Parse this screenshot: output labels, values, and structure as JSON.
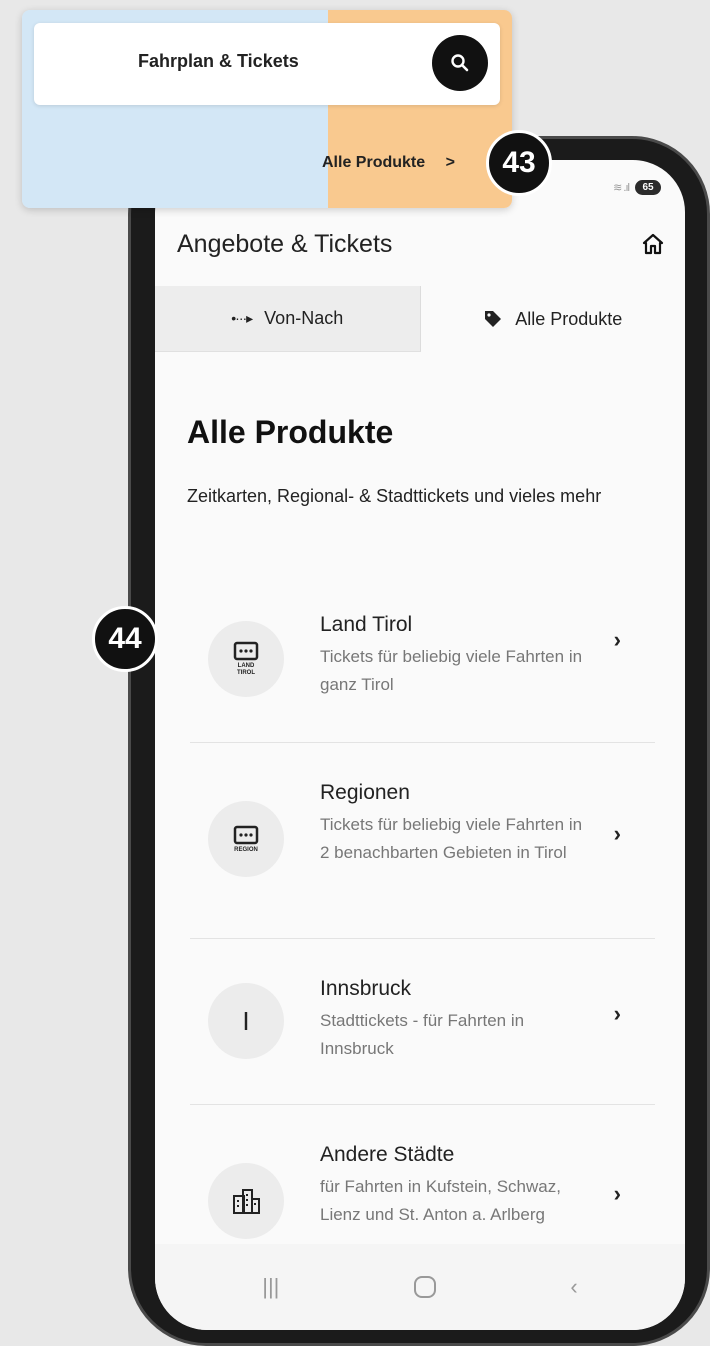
{
  "callout": {
    "search_label": "Fahrplan & Tickets",
    "link_label": "Alle Produkte",
    "link_chevron": ">"
  },
  "badges": {
    "top": "43",
    "side": "44"
  },
  "status_bar": {
    "battery": "65"
  },
  "header": {
    "title": "Angebote & Tickets"
  },
  "tabs": [
    {
      "label": "Von-Nach",
      "icon": "route-dots-icon"
    },
    {
      "label": "Alle Produkte",
      "icon": "tag-icon"
    }
  ],
  "page": {
    "title": "Alle Produkte",
    "subtitle": "Zeitkarten, Regional- & Stadttickets und vieles mehr"
  },
  "products": [
    {
      "name": "Land Tirol",
      "description": "Tickets für beliebig viele Fahrten in ganz Tirol",
      "icon_label": "LAND TIROL",
      "icon": "ticket-land-icon"
    },
    {
      "name": "Regionen",
      "description": "Tickets für beliebig viele Fahrten in 2 benachbarten Gebieten in Tirol",
      "icon_label": "REGION",
      "icon": "ticket-region-icon"
    },
    {
      "name": "Innsbruck",
      "description": "Stadttickets - für Fahrten in Innsbruck",
      "icon_label": "I",
      "icon": "innsbruck-icon"
    },
    {
      "name": "Andere Städte",
      "description": "für Fahrten in Kufstein, Schwaz, Lienz und St. Anton a. Arlberg",
      "icon": "buildings-icon"
    }
  ],
  "colors": {
    "callout_left": "#d3e7f6",
    "callout_right": "#f9c98f",
    "badge": "#111111"
  }
}
